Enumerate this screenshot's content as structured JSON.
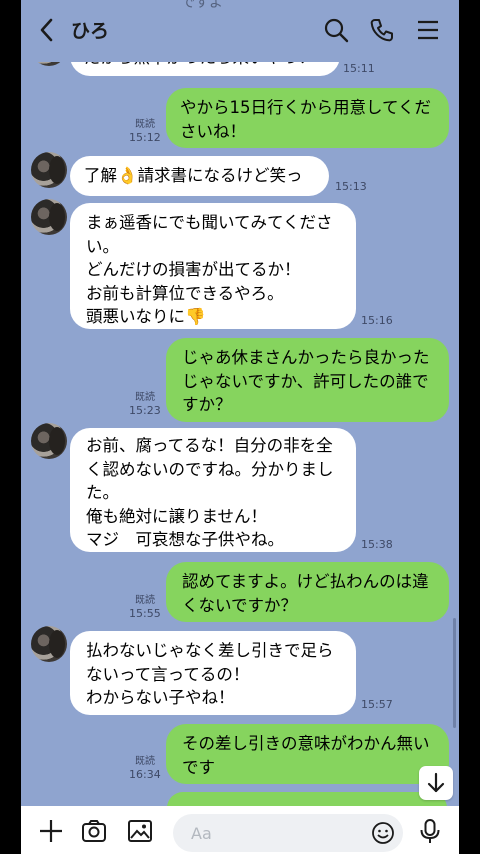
{
  "header": {
    "title": "ひろ",
    "back_icon": "back-chevron-icon",
    "search_icon": "search-icon",
    "call_icon": "phone-icon",
    "menu_icon": "menu-icon",
    "top_peek": "ですよ"
  },
  "messages": [
    {
      "dir": "in",
      "text": "だから熱下がったら来いやっ！",
      "time": "15:11"
    },
    {
      "dir": "out",
      "text": "やから15日行くから用意してくださいね！",
      "read": "既読",
      "time": "15:12"
    },
    {
      "dir": "in",
      "text": "了解👌請求書になるけど笑っ",
      "time": "15:13"
    },
    {
      "dir": "in",
      "text": "まぁ遥香にでも聞いてみてください。\nどんだけの損害が出てるか！\nお前も計算位できるやろ。\n頭悪いなりに👎",
      "time": "15:16"
    },
    {
      "dir": "out",
      "text": "じゃあ休まさんかったら良かったじゃないですか、許可したの誰ですか？",
      "read": "既読",
      "time": "15:23"
    },
    {
      "dir": "in",
      "text": "お前、腐ってるな！自分の非を全く認めないのですね。分かりました。\n俺も絶対に譲りません！\nマジ　可哀想な子供やね。",
      "time": "15:38"
    },
    {
      "dir": "out",
      "text": "認めてますよ。けど払わんのは違くないですか？",
      "read": "既読",
      "time": "15:55"
    },
    {
      "dir": "in",
      "text": "払わないじゃなく差し引きで足らないって言ってるの！\nわからない子やね！",
      "time": "15:57"
    },
    {
      "dir": "out",
      "text": "その差し引きの意味がわかん無いです",
      "read": "既読",
      "time": "16:34"
    }
  ],
  "footer": {
    "placeholder": "Aa",
    "add_icon": "plus-icon",
    "camera_icon": "camera-icon",
    "image_icon": "image-icon",
    "emoji_icon": "emoji-icon",
    "mic_icon": "mic-icon"
  },
  "colors": {
    "background": "#8fa4cf",
    "outgoing": "#86d45e",
    "incoming": "#ffffff"
  }
}
